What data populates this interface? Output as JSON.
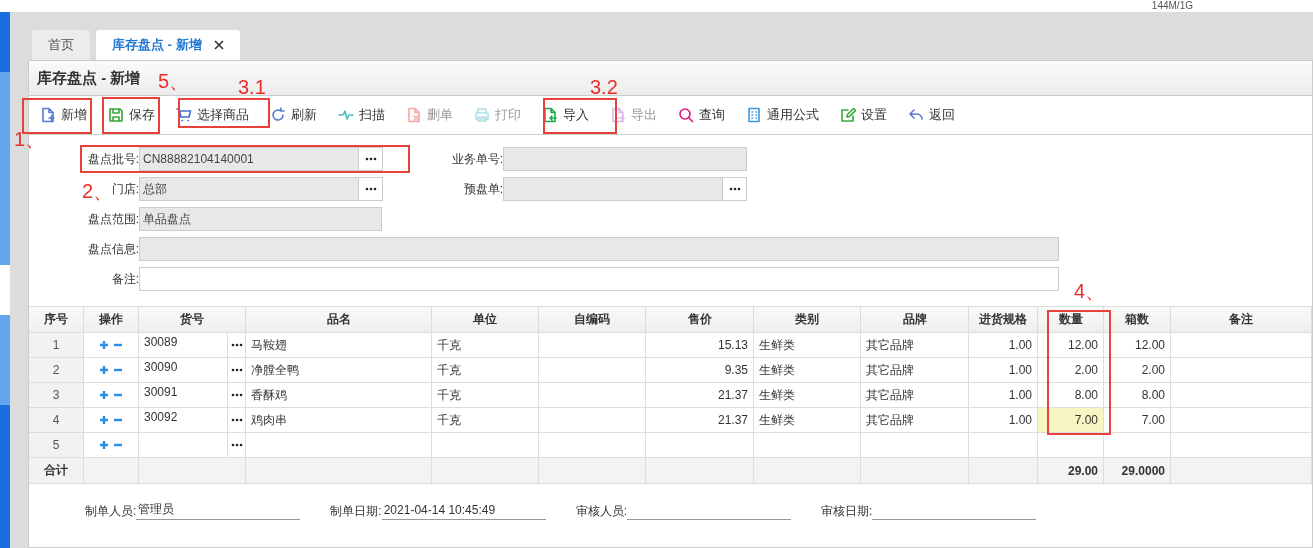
{
  "status_text": "144M/1G",
  "tabs": [
    {
      "label": "首页",
      "selected": false,
      "closable": false
    },
    {
      "label": "库存盘点 - 新增",
      "selected": true,
      "closable": true
    }
  ],
  "panel_title": "库存盘点 - 新增",
  "toolbar": [
    {
      "label": "新增",
      "disabled": false
    },
    {
      "label": "保存",
      "disabled": false
    },
    {
      "label": "选择商品",
      "disabled": false
    },
    {
      "label": "刷新",
      "disabled": false
    },
    {
      "label": "扫描",
      "disabled": false
    },
    {
      "label": "删单",
      "disabled": true
    },
    {
      "label": "打印",
      "disabled": true
    },
    {
      "label": "导入",
      "disabled": false
    },
    {
      "label": "导出",
      "disabled": true
    },
    {
      "label": "查询",
      "disabled": false
    },
    {
      "label": "通用公式",
      "disabled": false
    },
    {
      "label": "设置",
      "disabled": false
    },
    {
      "label": "返回",
      "disabled": false
    }
  ],
  "form": {
    "batch_no": {
      "label": "盘点批号:",
      "value": "CN88882104140001",
      "readonly": true
    },
    "business_no": {
      "label": "业务单号:",
      "readonly": true
    },
    "store": {
      "label": "门店:",
      "value": "总部",
      "readonly": true
    },
    "pre_count": {
      "label": "预盘单:",
      "readonly": true
    },
    "scope": {
      "label": "盘点范围:",
      "value": "单品盘点",
      "readonly": true
    },
    "info": {
      "label": "盘点信息:",
      "readonly": true
    },
    "remark": {
      "label": "备注:",
      "readonly": false
    }
  },
  "table": {
    "columns": [
      "序号",
      "操作",
      "货号",
      "品名",
      "单位",
      "自编码",
      "售价",
      "类别",
      "品牌",
      "进货规格",
      "数量",
      "箱数",
      "备注"
    ],
    "rows": [
      {
        "seq": "1",
        "code": "30089",
        "name": "马鞍翅",
        "unit": "千克",
        "price": "15.13",
        "category": "生鲜类",
        "brand": "其它品牌",
        "spec": "1.00",
        "qty": "12.00",
        "boxes": "12.00",
        "highlighted": false
      },
      {
        "seq": "2",
        "code": "30090",
        "name": "净膛全鸭",
        "unit": "千克",
        "price": "9.35",
        "category": "生鲜类",
        "brand": "其它品牌",
        "spec": "1.00",
        "qty": "2.00",
        "boxes": "2.00",
        "highlighted": false
      },
      {
        "seq": "3",
        "code": "30091",
        "name": "香酥鸡",
        "unit": "千克",
        "price": "21.37",
        "category": "生鲜类",
        "brand": "其它品牌",
        "spec": "1.00",
        "qty": "8.00",
        "boxes": "8.00",
        "highlighted": false
      },
      {
        "seq": "4",
        "code": "30092",
        "name": "鸡肉串",
        "unit": "千克",
        "price": "21.37",
        "category": "生鲜类",
        "brand": "其它品牌",
        "spec": "1.00",
        "qty": "7.00",
        "boxes": "7.00",
        "highlighted": true
      },
      {
        "seq": "5",
        "highlighted": false
      }
    ],
    "totals": {
      "label": "合计",
      "qty": "29.00",
      "boxes": "29.0000"
    }
  },
  "footer": [
    {
      "label": "制单人员:",
      "value": "管理员"
    },
    {
      "label": "制单日期:",
      "value": "2021-04-14 10:45:49"
    },
    {
      "label": "审核人员:"
    },
    {
      "label": "审核日期:"
    }
  ],
  "annotations": [
    {
      "label": "1、"
    },
    {
      "label": "5、"
    },
    {
      "label": "3.1"
    },
    {
      "label": "3.2"
    },
    {
      "label": "2、"
    },
    {
      "label": "4、"
    }
  ]
}
